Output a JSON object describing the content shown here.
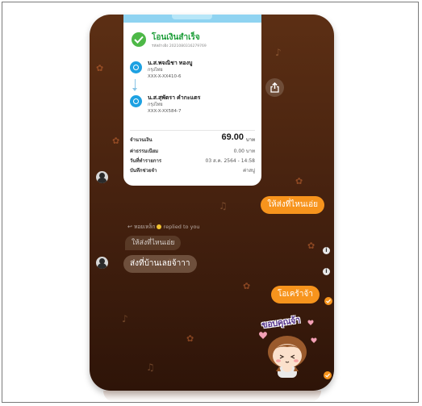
{
  "transfer_slip": {
    "status_title": "โอนเงินสำเร็จ",
    "reference": "รหัสอ้างอิง 2021080316279769",
    "sender": {
      "name": "น.ส.พจณิชา ทองบู",
      "bank": "กรุงไทย",
      "account": "XXX-X-XX410-6"
    },
    "receiver": {
      "name": "น.ส.สุพัตรา คำกะแตร",
      "bank": "กรุงไทย",
      "account": "XXX-X-XX584-7"
    },
    "amount_label": "จำนวนเงิน",
    "amount_value": "69.00",
    "amount_unit": "บาท",
    "fee_label": "ค่าธรรมเนียม",
    "fee_value": "0.00 บาท",
    "date_label": "วันที่ทำรายการ",
    "date_value": "03 ส.ค. 2564 - 14:58",
    "memo_label": "บันทึกช่วยจำ",
    "memo_value": "ค่าสบู่"
  },
  "chat": {
    "msg_out_1": "ให้ส่งที่ไหนเอ่ย",
    "reply_header_name": "หอยเหล็ก",
    "reply_header_text": "replied to you",
    "quoted_text": "ให้ส่งที่ไหนเอ่ย",
    "msg_in_reply": "ส่งที่บ้านเลยจ้าาา",
    "msg_out_2": "โอเคร้าจ้า",
    "sticker_text": "ขอบคุณจ้า"
  },
  "colors": {
    "accent_orange": "#f7941d",
    "success_green": "#1e9e3a",
    "chat_background": "#4a2410"
  },
  "icons": {
    "share": "share-icon",
    "check": "check-icon",
    "bank": "krungthai-bank-icon",
    "info": "info-icon"
  }
}
